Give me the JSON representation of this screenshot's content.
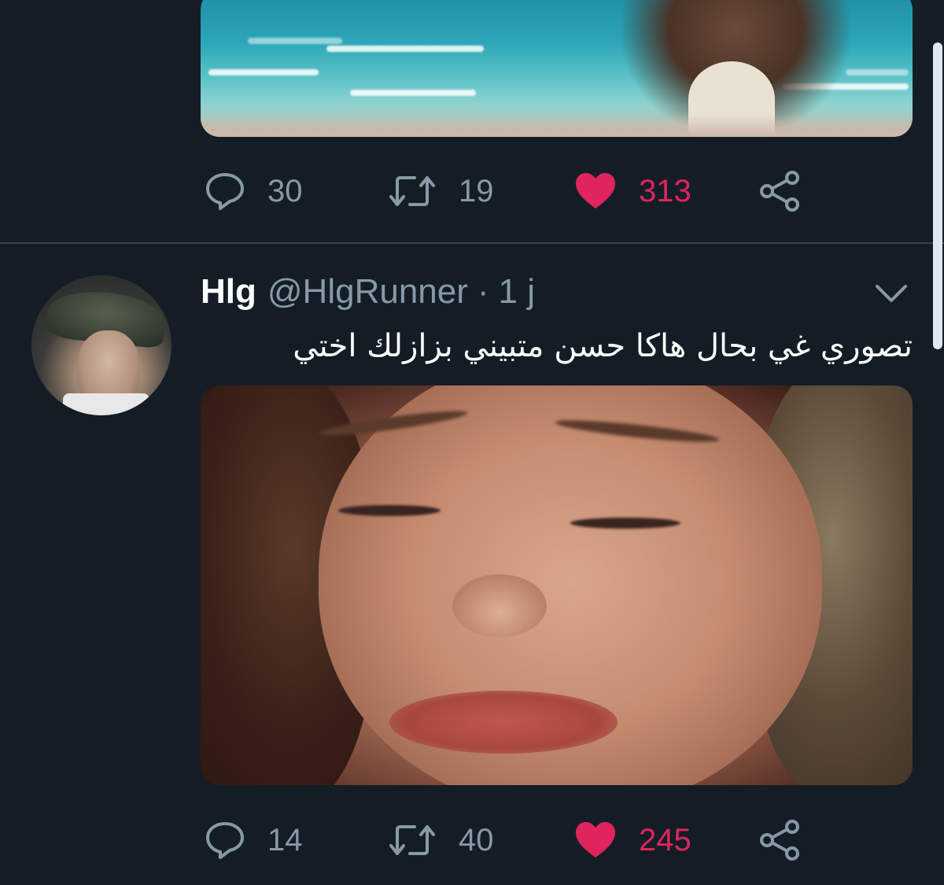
{
  "tweet1": {
    "actions": {
      "reply_count": "30",
      "retweet_count": "19",
      "like_count": "313"
    }
  },
  "tweet2": {
    "display_name": "Hlg",
    "handle": "@HlgRunner",
    "separator": "·",
    "time": "1 j",
    "text": "تصوري غي بحال هاكا حسن متبيني بزازلك اختي",
    "actions": {
      "reply_count": "14",
      "retweet_count": "40",
      "like_count": "245"
    }
  },
  "icons": {
    "reply": "reply-icon",
    "retweet": "retweet-icon",
    "like": "heart-icon",
    "share": "share-icon",
    "menu": "chevron-down-icon"
  },
  "colors": {
    "background": "#141d26",
    "secondary_text": "#8899a6",
    "like": "#e0245e",
    "divider": "#38444d"
  }
}
